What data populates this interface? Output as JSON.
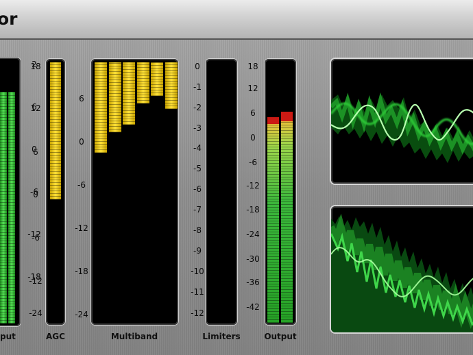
{
  "window": {
    "title": "or"
  },
  "meters": {
    "input": {
      "label": "put",
      "scale": [
        "2",
        "6",
        "0",
        "-6",
        "-12",
        "-18"
      ],
      "levels": [
        0.88,
        0.88
      ]
    },
    "agc": {
      "label": "AGC",
      "scale": [
        "18",
        "12",
        "6",
        "0",
        "-6",
        "-12",
        "-24"
      ],
      "level": 0.53
    },
    "multiband": {
      "label": "Multiband",
      "scale": [
        "6",
        "0",
        "-6",
        "-12",
        "-18",
        "-24"
      ],
      "levels": [
        0.35,
        0.27,
        0.24,
        0.16,
        0.13,
        0.18
      ]
    },
    "limiters": {
      "label": "Limiters",
      "scale": [
        "0",
        "-1",
        "-2",
        "-3",
        "-4",
        "-5",
        "-6",
        "-7",
        "-8",
        "-9",
        "-10",
        "-11",
        "-12"
      ]
    },
    "output": {
      "label": "Output",
      "scale": [
        "18",
        "12",
        "6",
        "0",
        "-6",
        "-12",
        "-18",
        "-24",
        "-30",
        "-36",
        "-42"
      ],
      "levels": [
        0.76,
        0.77
      ],
      "peak_color": "#cc1a14"
    }
  },
  "scopes": {
    "top": {
      "name": "oscilloscope-waveform"
    },
    "bottom": {
      "name": "spectrum-scope"
    }
  },
  "colors": {
    "meter_yellow": "#ffe23a",
    "meter_green": "#3bb83b",
    "peak_red": "#cc1a14",
    "scope_green": "#33ff44"
  }
}
